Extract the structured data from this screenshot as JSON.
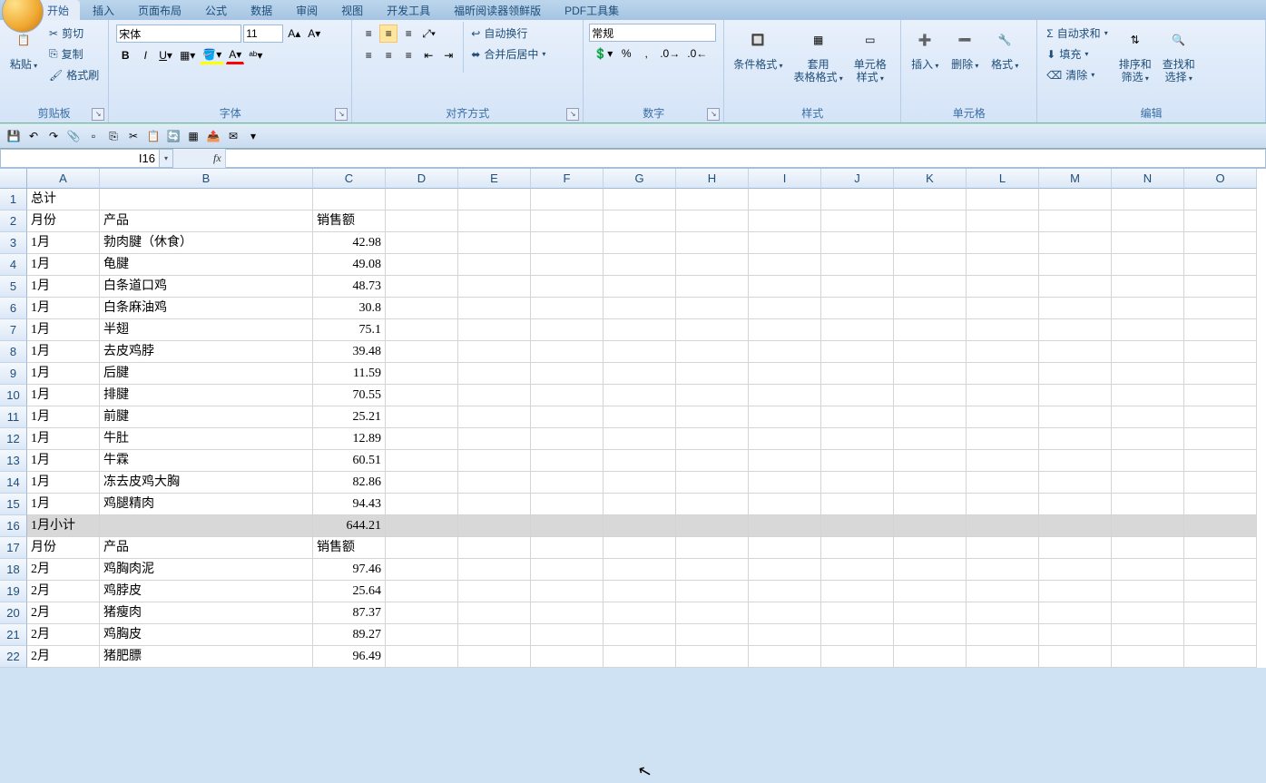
{
  "tabs": {
    "items": [
      "开始",
      "插入",
      "页面布局",
      "公式",
      "数据",
      "审阅",
      "视图",
      "开发工具",
      "福昕阅读器领鲜版",
      "PDF工具集"
    ],
    "active_index": 0
  },
  "ribbon": {
    "clipboard": {
      "paste": "粘贴",
      "cut": "剪切",
      "copy": "复制",
      "painter": "格式刷",
      "title": "剪贴板"
    },
    "font": {
      "name": "宋体",
      "size": "11",
      "title": "字体"
    },
    "align": {
      "wrap": "自动换行",
      "merge": "合并后居中",
      "title": "对齐方式"
    },
    "number": {
      "format": "常规",
      "title": "数字"
    },
    "styles": {
      "cond": "条件格式",
      "table": "套用\n表格格式",
      "cell": "单元格\n样式",
      "title": "样式"
    },
    "cells": {
      "insert": "插入",
      "delete": "删除",
      "format": "格式",
      "title": "单元格"
    },
    "editing": {
      "sum": "自动求和",
      "fill": "填充",
      "clear": "清除",
      "sort": "排序和\n筛选",
      "find": "查找和\n选择",
      "title": "编辑"
    }
  },
  "namebox": "I16",
  "formula": "",
  "columns": [
    "A",
    "B",
    "C",
    "D",
    "E",
    "F",
    "G",
    "H",
    "I",
    "J",
    "K",
    "L",
    "M",
    "N",
    "O"
  ],
  "rows": [
    {
      "n": "1",
      "a": "总计",
      "b": "",
      "c": ""
    },
    {
      "n": "2",
      "a": "月份",
      "b": "产品",
      "c": "销售额"
    },
    {
      "n": "3",
      "a": "1月",
      "b": "勃肉腱（休食）",
      "c": "42.98"
    },
    {
      "n": "4",
      "a": "1月",
      "b": "龟腱",
      "c": "49.08"
    },
    {
      "n": "5",
      "a": "1月",
      "b": "白条道口鸡",
      "c": "48.73"
    },
    {
      "n": "6",
      "a": "1月",
      "b": "白条麻油鸡",
      "c": "30.8"
    },
    {
      "n": "7",
      "a": "1月",
      "b": "半翅",
      "c": "75.1"
    },
    {
      "n": "8",
      "a": "1月",
      "b": "去皮鸡脖",
      "c": "39.48"
    },
    {
      "n": "9",
      "a": "1月",
      "b": "后腱",
      "c": "11.59"
    },
    {
      "n": "10",
      "a": "1月",
      "b": "排腱",
      "c": "70.55"
    },
    {
      "n": "11",
      "a": "1月",
      "b": "前腱",
      "c": "25.21"
    },
    {
      "n": "12",
      "a": "1月",
      "b": "牛肚",
      "c": "12.89"
    },
    {
      "n": "13",
      "a": "1月",
      "b": "牛霖",
      "c": "60.51"
    },
    {
      "n": "14",
      "a": "1月",
      "b": "冻去皮鸡大胸",
      "c": "82.86"
    },
    {
      "n": "15",
      "a": "1月",
      "b": "鸡腿精肉",
      "c": "94.43"
    },
    {
      "n": "16",
      "a": "1月小计",
      "b": "",
      "c": "644.21",
      "hl": true
    },
    {
      "n": "17",
      "a": "月份",
      "b": "产品",
      "c": "销售额"
    },
    {
      "n": "18",
      "a": "2月",
      "b": "鸡胸肉泥",
      "c": "97.46"
    },
    {
      "n": "19",
      "a": "2月",
      "b": "鸡脖皮",
      "c": "25.64"
    },
    {
      "n": "20",
      "a": "2月",
      "b": "猪瘦肉",
      "c": "87.37"
    },
    {
      "n": "21",
      "a": "2月",
      "b": "鸡胸皮",
      "c": "89.27"
    },
    {
      "n": "22",
      "a": "2月",
      "b": "猪肥膘",
      "c": "96.49"
    }
  ],
  "chart_data": {
    "type": "table",
    "title": "销售额",
    "columns": [
      "月份",
      "产品",
      "销售额"
    ],
    "records": [
      [
        "1月",
        "勃肉腱（休食）",
        42.98
      ],
      [
        "1月",
        "龟腱",
        49.08
      ],
      [
        "1月",
        "白条道口鸡",
        48.73
      ],
      [
        "1月",
        "白条麻油鸡",
        30.8
      ],
      [
        "1月",
        "半翅",
        75.1
      ],
      [
        "1月",
        "去皮鸡脖",
        39.48
      ],
      [
        "1月",
        "后腱",
        11.59
      ],
      [
        "1月",
        "排腱",
        70.55
      ],
      [
        "1月",
        "前腱",
        25.21
      ],
      [
        "1月",
        "牛肚",
        12.89
      ],
      [
        "1月",
        "牛霖",
        60.51
      ],
      [
        "1月",
        "冻去皮鸡大胸",
        82.86
      ],
      [
        "1月",
        "鸡腿精肉",
        94.43
      ],
      [
        "1月小计",
        "",
        644.21
      ],
      [
        "2月",
        "鸡胸肉泥",
        97.46
      ],
      [
        "2月",
        "鸡脖皮",
        25.64
      ],
      [
        "2月",
        "猪瘦肉",
        87.37
      ],
      [
        "2月",
        "鸡胸皮",
        89.27
      ],
      [
        "2月",
        "猪肥膘",
        96.49
      ]
    ]
  }
}
